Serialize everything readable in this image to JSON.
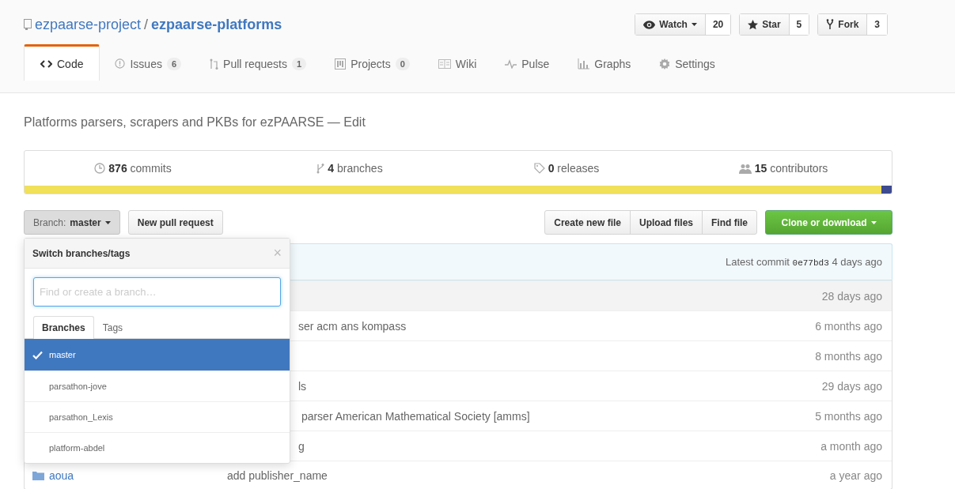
{
  "repo": {
    "owner": "ezpaarse-project",
    "separator": "/",
    "name": "ezpaarse-platforms"
  },
  "social": [
    {
      "kind": "watch",
      "label": "Watch",
      "count": "20",
      "dropdown": true
    },
    {
      "kind": "star",
      "label": "Star",
      "count": "5",
      "dropdown": false
    },
    {
      "kind": "fork",
      "label": "Fork",
      "count": "3",
      "dropdown": false
    }
  ],
  "tabs": [
    {
      "kind": "code",
      "label": "Code",
      "selected": true
    },
    {
      "kind": "issues",
      "label": "Issues",
      "count": "6",
      "selected": false
    },
    {
      "kind": "pulls",
      "label": "Pull requests",
      "count": "1",
      "selected": false
    },
    {
      "kind": "projects",
      "label": "Projects",
      "count": "0",
      "selected": false
    },
    {
      "kind": "wiki",
      "label": "Wiki",
      "selected": false
    },
    {
      "kind": "pulse",
      "label": "Pulse",
      "selected": false
    },
    {
      "kind": "graphs",
      "label": "Graphs",
      "selected": false
    },
    {
      "kind": "settings",
      "label": "Settings",
      "selected": false
    }
  ],
  "description": {
    "text": "Platforms parsers, scrapers and PKBs for ezPAARSE —",
    "edit_link": "Edit"
  },
  "stats": [
    {
      "kind": "commits",
      "count": "876",
      "label": "commits"
    },
    {
      "kind": "branches",
      "count": "4",
      "label": "branches"
    },
    {
      "kind": "releases",
      "count": "0",
      "label": "releases"
    },
    {
      "kind": "contributors",
      "count": "15",
      "label": "contributors"
    }
  ],
  "languages": [
    {
      "color": "#f1e05a",
      "level": 0.988
    },
    {
      "color": "#3e4b8f",
      "level": 0.012
    }
  ],
  "branch_button": {
    "prefix": "Branch:",
    "branch": "master"
  },
  "new_pr_button": "New pull request",
  "file_buttons": [
    "Create new file",
    "Upload files",
    "Find file"
  ],
  "clone_button": "Clone or download",
  "commit_bar": {
    "label": "Latest commit",
    "sha": "0e77bd3",
    "age": "4 days ago"
  },
  "files": [
    {
      "age": "28 days ago",
      "highlighted": true
    },
    {
      "message": "ser acm ans kompass",
      "age": "6 months ago",
      "highlighted": false
    },
    {
      "age": "8 months ago",
      "highlighted": false
    },
    {
      "message": "ls",
      "age": "29 days ago",
      "highlighted": false
    },
    {
      "message": " parser American Mathematical Society [amms]",
      "age": "5 months ago",
      "highlighted": false
    },
    {
      "message": "g",
      "age": "a month ago",
      "highlighted": false
    },
    {
      "name": "aoua",
      "message": "add publisher_name",
      "age": "a year ago",
      "highlighted": false
    }
  ],
  "branch_menu": {
    "title": "Switch branches/tags",
    "close": "×",
    "placeholder": "Find or create a branch…",
    "tabs": [
      {
        "label": "Branches",
        "selected": true
      },
      {
        "label": "Tags",
        "selected": false
      }
    ],
    "items": [
      {
        "label": "master",
        "selected": true
      },
      {
        "label": "parsathon-jove",
        "selected": false
      },
      {
        "label": "parsathon_Lexis",
        "selected": false
      },
      {
        "label": "platform-abdel",
        "selected": false
      }
    ]
  }
}
